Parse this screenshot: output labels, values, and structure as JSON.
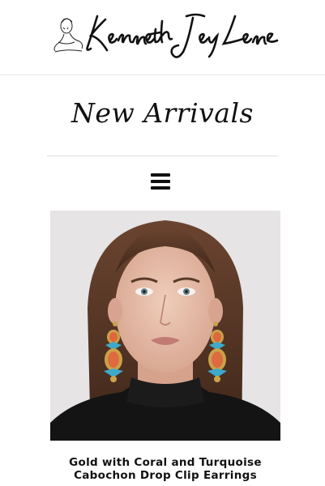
{
  "header": {
    "logo_text": "Kenneth Jay Lane",
    "logo_icon": "woman-sketch-icon"
  },
  "page": {
    "title": "New Arrivals"
  },
  "nav": {
    "menu_icon": "hamburger-menu-icon"
  },
  "product": {
    "name_line1": "Gold with Coral and Turquoise",
    "name_line2": "Cabochon Drop Clip Earrings"
  }
}
